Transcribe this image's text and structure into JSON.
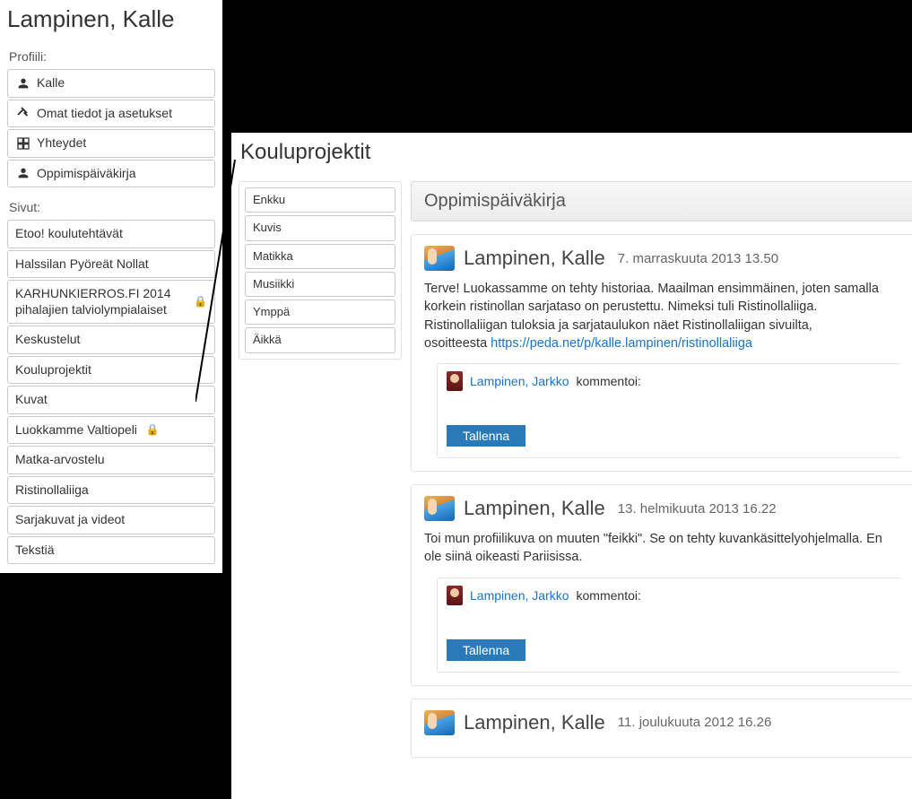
{
  "profile": {
    "title": "Lampinen, Kalle",
    "section1_label": "Profiili:",
    "items": [
      {
        "label": "Kalle",
        "icon": "user"
      },
      {
        "label": "Omat tiedot ja asetukset",
        "icon": "settings"
      },
      {
        "label": "Yhteydet",
        "icon": "grid"
      },
      {
        "label": "Oppimispäiväkirja",
        "icon": "user"
      }
    ],
    "section2_label": "Sivut:",
    "pages": [
      {
        "label": "Etoo! koulutehtävät",
        "locked": false
      },
      {
        "label": "Halssilan Pyöreät Nollat",
        "locked": false
      },
      {
        "label": "KARHUNKIERROS.FI 2014 pihalajien talviolympialaiset",
        "locked": true
      },
      {
        "label": "Keskustelut",
        "locked": false
      },
      {
        "label": "Kouluprojektit",
        "locked": false
      },
      {
        "label": "Kuvat",
        "locked": false
      },
      {
        "label": "Luokkamme Valtiopeli",
        "locked": true
      },
      {
        "label": "Matka-arvostelu",
        "locked": false
      },
      {
        "label": "Ristinollaliiga",
        "locked": false
      },
      {
        "label": "Sarjakuvat ja videot",
        "locked": false
      },
      {
        "label": "Tekstiä",
        "locked": false
      }
    ]
  },
  "right": {
    "title": "Kouluprojektit",
    "subnav": [
      "Enkku",
      "Kuvis",
      "Matikka",
      "Musiikki",
      "Ymppä",
      "Äikkä"
    ],
    "content_title": "Oppimispäiväkirja",
    "posts": [
      {
        "author": "Lampinen, Kalle",
        "date": "7. marraskuuta 2013 13.50",
        "body_pre": "Terve! Luokassamme on tehty historiaa. Maailman ensimmäinen, joten samalla korkein ristinollan sarjataso on perustettu. Nimeksi tuli Ristinollaliiga. Ristinollaliigan tuloksia ja sarjataulukon näet Ristinollaliigan sivuilta,\nosoitteesta ",
        "link_text": "https://peda.net/p/kalle.lampinen/ristinollaliiga",
        "commenter": "Lampinen, Jarkko",
        "commented_word": "kommentoi:",
        "save_label": "Tallenna"
      },
      {
        "author": "Lampinen, Kalle",
        "date": "13. helmikuuta 2013 16.22",
        "body_pre": "Toi mun profiilikuva on muuten \"feikki\". Se on tehty kuvankäsittelyohjelmalla. En ole siinä oikeasti Pariisissa.",
        "link_text": "",
        "commenter": "Lampinen, Jarkko",
        "commented_word": "kommentoi:",
        "save_label": "Tallenna"
      },
      {
        "author": "Lampinen, Kalle",
        "date": "11. joulukuuta 2012 16.26",
        "body_pre": "",
        "link_text": "",
        "commenter": "",
        "commented_word": "",
        "save_label": ""
      }
    ]
  }
}
